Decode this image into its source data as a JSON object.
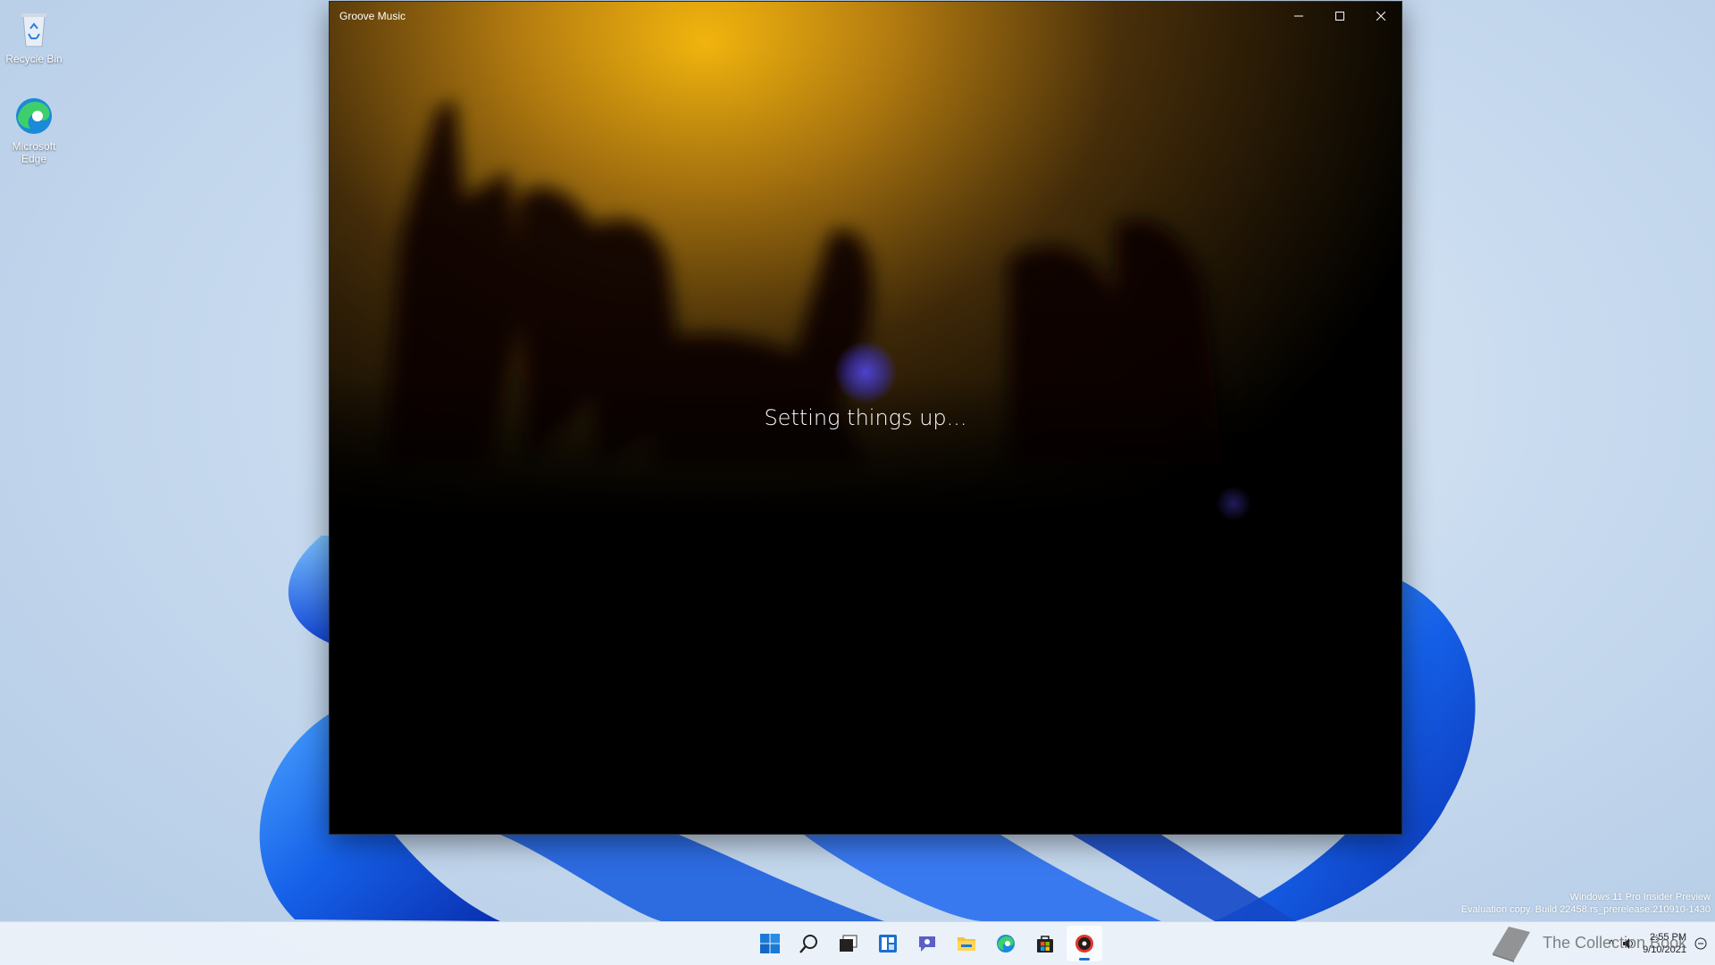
{
  "desktop": {
    "icons": [
      {
        "label": "Recycle Bin",
        "icon": "recycle-bin-icon"
      },
      {
        "label": "Microsoft Edge",
        "icon": "edge-icon"
      }
    ]
  },
  "window": {
    "title": "Groove Music",
    "status_text": "Setting things up...",
    "controls": {
      "minimize": "minimize-icon",
      "maximize": "maximize-icon",
      "close": "close-icon"
    }
  },
  "watermark": {
    "line1": "Windows 11 Pro Insider Preview",
    "line2": "Evaluation copy. Build 22458.rs_prerelease.210910-1430"
  },
  "taskbar": {
    "apps": [
      {
        "name": "start",
        "icon": "windows-start-icon"
      },
      {
        "name": "search",
        "icon": "search-icon"
      },
      {
        "name": "task-view",
        "icon": "task-view-icon"
      },
      {
        "name": "widgets",
        "icon": "widgets-icon"
      },
      {
        "name": "chat",
        "icon": "teams-chat-icon"
      },
      {
        "name": "file-explorer",
        "icon": "folder-icon"
      },
      {
        "name": "edge",
        "icon": "edge-icon"
      },
      {
        "name": "store",
        "icon": "store-icon"
      },
      {
        "name": "groove-music",
        "icon": "groove-music-icon",
        "active": true
      }
    ],
    "tray": {
      "time": "2:55 PM",
      "date": "9/10/2021"
    },
    "overlay_text": "The Collection Book"
  },
  "colors": {
    "accent": "#1a73c9",
    "window_bg": "#000000",
    "taskbar_bg": "#eef3fa"
  }
}
